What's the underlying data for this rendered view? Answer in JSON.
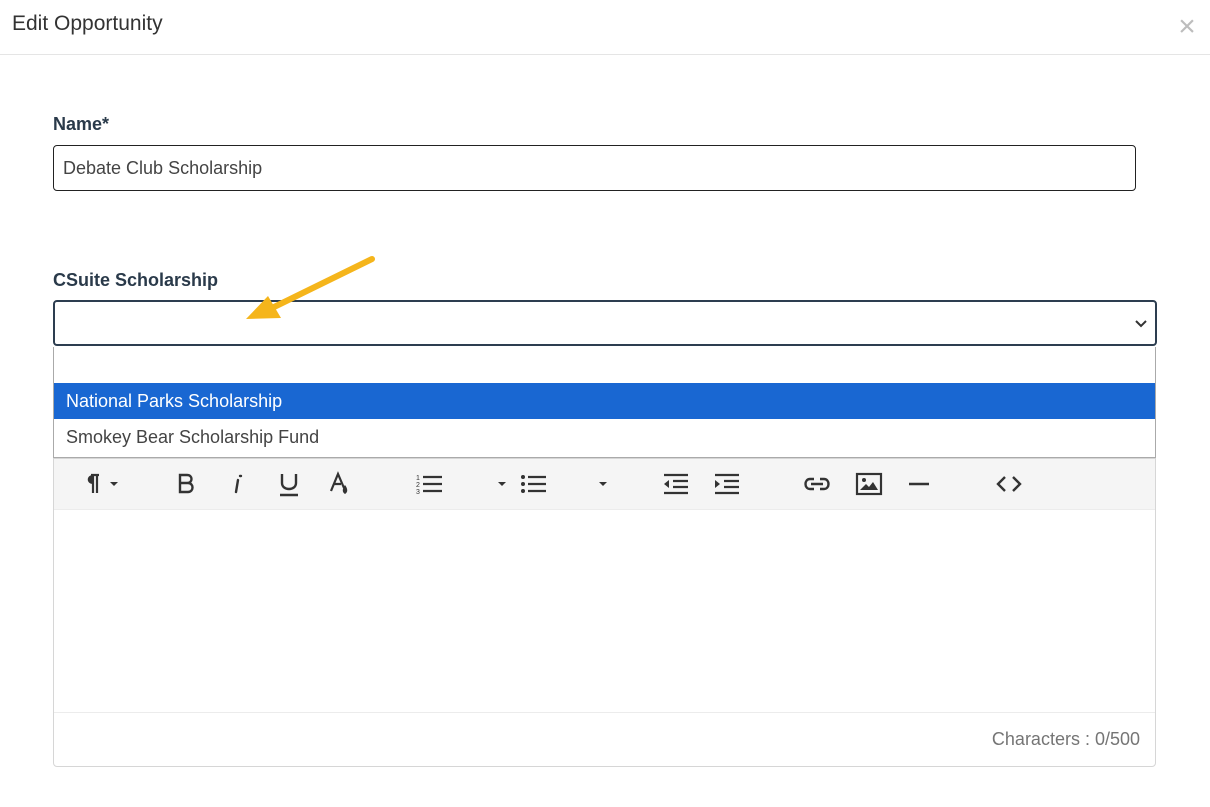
{
  "dialog": {
    "title": "Edit Opportunity",
    "close_icon": "×"
  },
  "form": {
    "name_label": "Name*",
    "name_value": "Debate Club Scholarship",
    "scholarship_label": "CSuite Scholarship",
    "scholarship_value": "",
    "dropdown_options": [
      "National Parks Scholarship",
      "Smokey Bear Scholarship Fund"
    ],
    "dropdown_highlighted": "National Parks Scholarship"
  },
  "editor": {
    "toolbar_icons": [
      "paragraph-format-icon",
      "bold-icon",
      "italic-icon",
      "underline-icon",
      "text-color-icon",
      "ordered-list-icon",
      "unordered-list-icon",
      "outdent-icon",
      "indent-icon",
      "insert-link-icon",
      "insert-image-icon",
      "horizontal-line-icon",
      "code-view-icon"
    ],
    "body_text": "",
    "char_counter": "Characters : 0/500"
  },
  "annotation": {
    "arrow_color": "#f5b51b"
  },
  "colors": {
    "highlight": "#1967d2",
    "label": "#2a3a4a"
  }
}
